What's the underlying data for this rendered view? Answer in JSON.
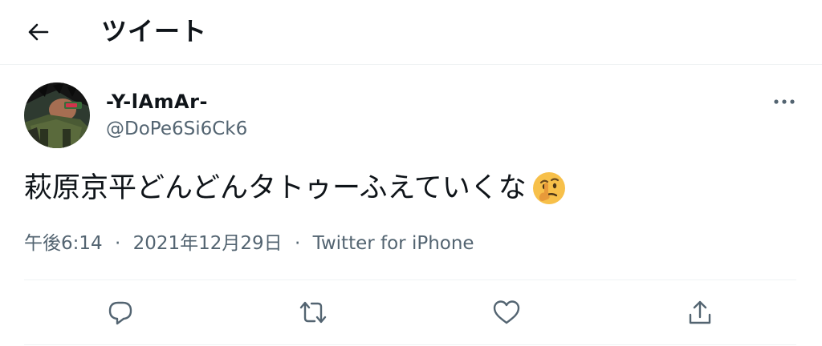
{
  "header": {
    "title": "ツイート",
    "back_icon": "arrow-left-icon"
  },
  "tweet": {
    "author": {
      "display_name": "-Y-lAmAr-",
      "handle": "@DoPe6Si6Ck6"
    },
    "text": "萩原京平どんどんタトゥーふえていくな",
    "emoji": "thinking-face-emoji",
    "time": "午後6:14",
    "separator": "·",
    "date": "2021年12月29日",
    "source": "Twitter for iPhone"
  },
  "actions": [
    "reply-icon",
    "retweet-icon",
    "like-icon",
    "share-icon"
  ],
  "colors": {
    "text": "#0f1419",
    "secondary": "#536471",
    "divider": "#eff3f4",
    "icon": "#536471"
  }
}
